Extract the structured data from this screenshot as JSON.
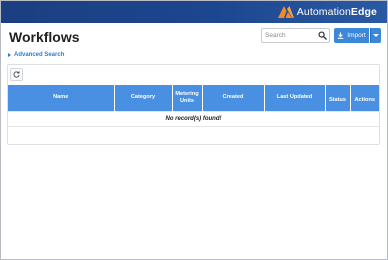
{
  "brand": {
    "name_part1": "Automation",
    "name_part2": "Edge",
    "accent": "#f28c28"
  },
  "header": {
    "bar_color": "#1d4690"
  },
  "page": {
    "title": "Workflows"
  },
  "search": {
    "placeholder": "Search",
    "value": "",
    "icon": "search-icon"
  },
  "toolbar": {
    "import_label": "Import",
    "import_icon": "download-icon",
    "dropdown_icon": "caret-down-icon"
  },
  "advanced_search": {
    "label": "Advanced Search"
  },
  "grid": {
    "refresh_icon": "refresh-icon",
    "header_color": "#4a90e2",
    "columns": [
      "Name",
      "Category",
      "Metering Units",
      "Created",
      "Last Updated",
      "Status",
      "Actions"
    ],
    "empty_message": "No record(s) found!"
  }
}
